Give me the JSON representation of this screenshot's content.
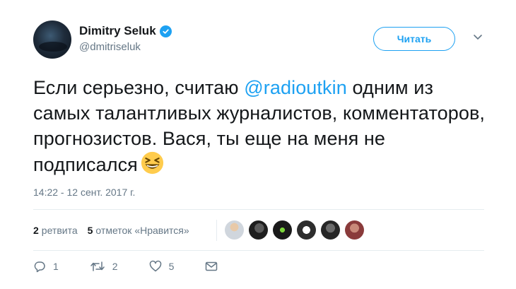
{
  "author": {
    "display_name": "Dimitry Seluk",
    "handle": "@dmitriseluk",
    "verified": true
  },
  "follow_button": {
    "label": "Читать"
  },
  "tweet": {
    "text_before": "Если серьезно, считаю ",
    "mention": "@radioutkin",
    "text_after": " одним из самых талантливых журналистов, комментаторов, прогнозистов. Вася, ты еще на меня не подписался",
    "emoji": "grinning-squinting-face",
    "timestamp": "14:22 - 12 сент. 2017 г."
  },
  "stats": {
    "retweets_count": "2",
    "retweets_label": "ретвита",
    "likes_count": "5",
    "likes_label": "отметок «Нравится»"
  },
  "liker_avatars": [
    "avatar-1",
    "avatar-2",
    "avatar-3",
    "avatar-4",
    "avatar-5",
    "avatar-6"
  ],
  "actions": {
    "reply_count": "1",
    "retweet_count": "2",
    "like_count": "5"
  },
  "colors": {
    "accent": "#1da1f2",
    "text": "#14171a",
    "secondary": "#657786",
    "divider": "#e6ecf0"
  }
}
